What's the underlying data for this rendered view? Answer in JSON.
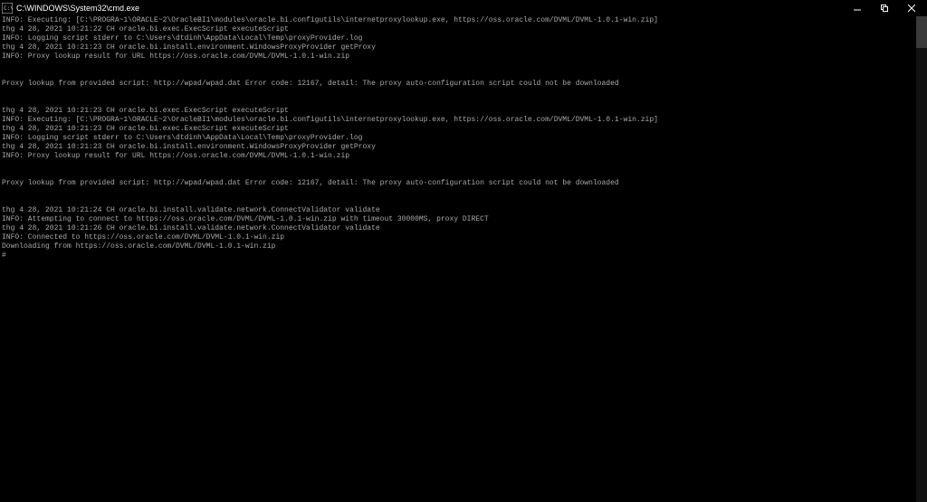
{
  "window": {
    "title": "C:\\WINDOWS\\System32\\cmd.exe"
  },
  "terminal": {
    "lines": [
      "INFO: Executing: [C:\\PROGRA~1\\ORACLE~2\\OracleBI1\\modules\\oracle.bi.configutils\\internetproxylookup.exe, https://oss.oracle.com/DVML/DVML-1.0.1-win.zip]",
      "thg 4 28, 2021 10:21:22 CH oracle.bi.exec.ExecScript executeScript",
      "INFO: Logging script stderr to C:\\Users\\dtdinh\\AppData\\Local\\Temp\\proxyProvider.log",
      "thg 4 28, 2021 10:21:23 CH oracle.bi.install.environment.WindowsProxyProvider getProxy",
      "INFO: Proxy lookup result for URL https://oss.oracle.com/DVML/DVML-1.0.1-win.zip",
      "",
      "",
      "Proxy lookup from provided script: http://wpad/wpad.dat Error code: 12167, detail: The proxy auto-configuration script could not be downloaded",
      "",
      "",
      "thg 4 28, 2021 10:21:23 CH oracle.bi.exec.ExecScript executeScript",
      "INFO: Executing: [C:\\PROGRA~1\\ORACLE~2\\OracleBI1\\modules\\oracle.bi.configutils\\internetproxylookup.exe, https://oss.oracle.com/DVML/DVML-1.0.1-win.zip]",
      "thg 4 28, 2021 10:21:23 CH oracle.bi.exec.ExecScript executeScript",
      "INFO: Logging script stderr to C:\\Users\\dtdinh\\AppData\\Local\\Temp\\proxyProvider.log",
      "thg 4 28, 2021 10:21:23 CH oracle.bi.install.environment.WindowsProxyProvider getProxy",
      "INFO: Proxy lookup result for URL https://oss.oracle.com/DVML/DVML-1.0.1-win.zip",
      "",
      "",
      "Proxy lookup from provided script: http://wpad/wpad.dat Error code: 12167, detail: The proxy auto-configuration script could not be downloaded",
      "",
      "",
      "thg 4 28, 2021 10:21:24 CH oracle.bi.install.validate.network.ConnectValidator validate",
      "INFO: Attempting to connect to https://oss.oracle.com/DVML/DVML-1.0.1-win.zip with timeout 30000MS, proxy DIRECT",
      "thg 4 28, 2021 10:21:26 CH oracle.bi.install.validate.network.ConnectValidator validate",
      "INFO: Connected to https://oss.oracle.com/DVML/DVML-1.0.1-win.zip",
      "Downloading from https://oss.oracle.com/DVML/DVML-1.0.1-win.zip",
      "#"
    ]
  }
}
